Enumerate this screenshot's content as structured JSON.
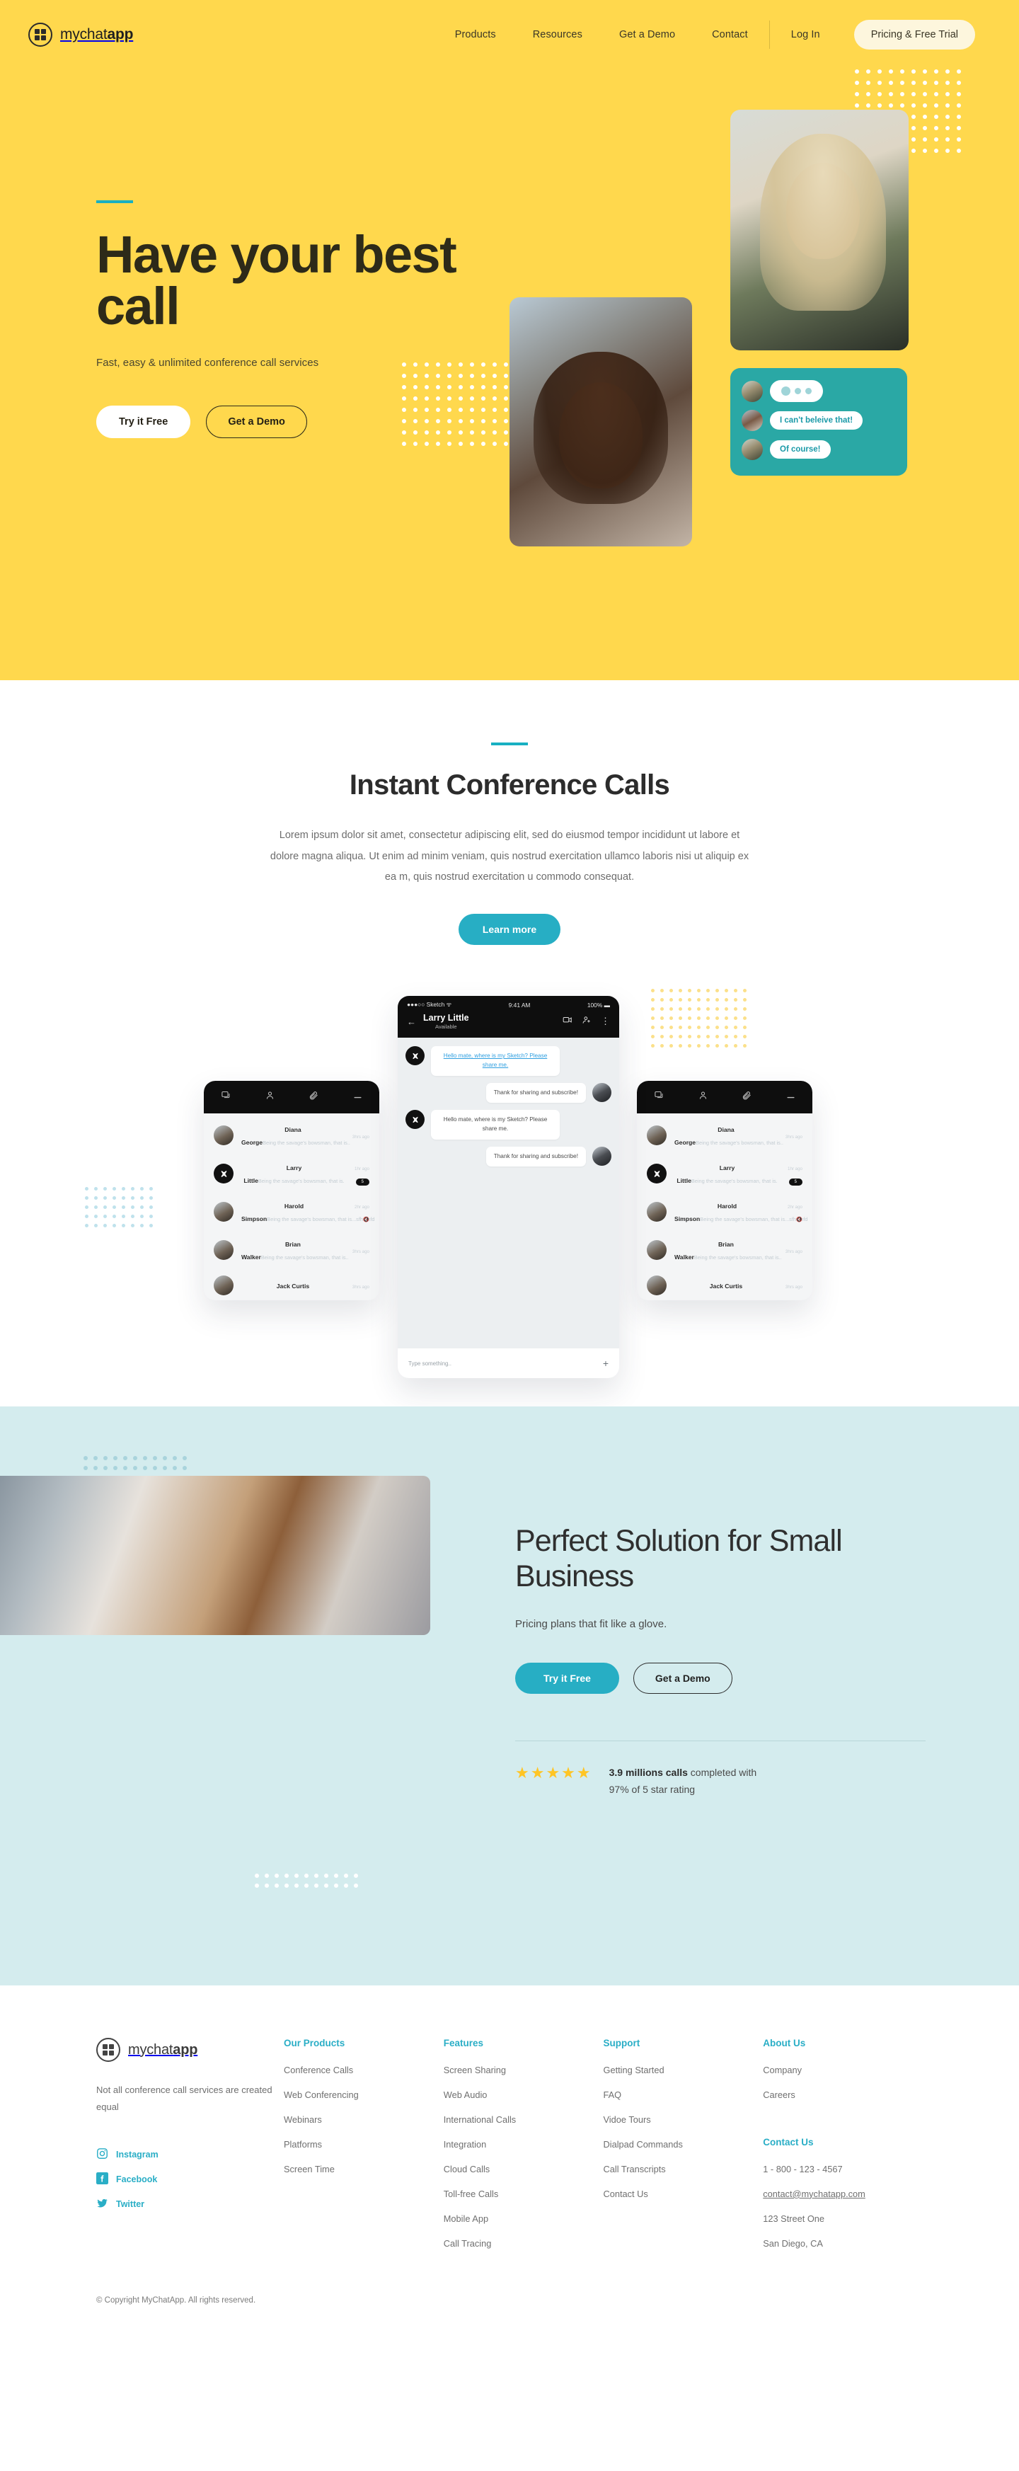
{
  "brand": {
    "name_light": "mychat",
    "name_bold": "app",
    "icon": "grid-logo-icon"
  },
  "nav": {
    "links": [
      {
        "label": "Products"
      },
      {
        "label": "Resources"
      },
      {
        "label": "Get a Demo"
      },
      {
        "label": "Contact"
      }
    ],
    "login_label": "Log In",
    "cta_label": "Pricing & Free Trial"
  },
  "hero": {
    "heading": "Have your best call",
    "subheading": "Fast, easy & unlimited conference call services",
    "primary_button": "Try it Free",
    "secondary_button": "Get a Demo",
    "accent_color": "#18b0c2",
    "background_color": "#ffd84d",
    "chat_card": {
      "background_color": "#2aa8a5",
      "messages": [
        {
          "text": "",
          "typing": true
        },
        {
          "text": "I can't beleive that!",
          "typing": false
        },
        {
          "text": "Of course!",
          "typing": false
        }
      ]
    }
  },
  "section_conference": {
    "title": "Instant Conference Calls",
    "body": "Lorem ipsum dolor sit amet, consectetur adipiscing elit, sed do eiusmod tempor incididunt ut labore et dolore magna aliqua. Ut enim ad minim veniam, quis nostrud exercitation ullamco laboris nisi ut aliquip ex ea m, quis nostrud exercitation u commodo consequat.",
    "button_label": "Learn more",
    "accent_color": "#18b0c2",
    "button_color": "#27aec4"
  },
  "phone_mockup": {
    "status_carrier": "Sketch",
    "status_time": "9:41 AM",
    "status_battery": "100%",
    "chat_title": "Larry Little",
    "chat_status": "Available",
    "input_placeholder": "Type something..",
    "messages": [
      {
        "side": "left",
        "text": "Hello mate, where is my Sketch? Please share me.",
        "link": true
      },
      {
        "side": "right",
        "text": "Thank for sharing and subscribe!",
        "link": false
      },
      {
        "side": "left",
        "text": "Hello mate, where is my Sketch? Please share me.",
        "link": false
      },
      {
        "side": "right",
        "text": "Thank for sharing and subscribe!",
        "link": false
      }
    ],
    "contacts": [
      {
        "name": "Diana George",
        "preview": "Being the savage's bowsman, that is..",
        "time": "3hrs ago",
        "badge": "",
        "muted": false
      },
      {
        "name": "Larry Little",
        "preview": "Being the savage's bowsman, that is.",
        "time": "1hr ago",
        "badge": "5",
        "muted": false
      },
      {
        "name": "Harold Simpson",
        "preview": "Being the savage's bowsman, that is...sfhdfhfd",
        "time": "2hr ago",
        "badge": "",
        "muted": true
      },
      {
        "name": "Brian Walker",
        "preview": "Being the savage's bowsman, that is..",
        "time": "3hrs ago",
        "badge": "",
        "muted": false
      },
      {
        "name": "Jack Curtis",
        "preview": "",
        "time": "3hrs ago",
        "badge": "",
        "muted": false
      }
    ],
    "tabbar_icons": [
      "chat-icon",
      "person-icon",
      "attachment-icon",
      "menu-icon"
    ]
  },
  "section_business": {
    "title": "Perfect Solution for Small Business",
    "subtitle": "Pricing plans that fit like a glove.",
    "primary_button": "Try it Free",
    "secondary_button": "Get a Demo",
    "stars": "★★★★★",
    "stat_bold": "3.9 millions calls",
    "stat_rest": " completed with",
    "stat_line2": "97% of 5 star rating",
    "background_color": "#d4ecee",
    "star_color": "#ffc525"
  },
  "footer": {
    "tagline": "Not all conference call services are created equal",
    "socials": [
      {
        "label": "Instagram",
        "icon": "instagram-icon"
      },
      {
        "label": "Facebook",
        "icon": "facebook-icon"
      },
      {
        "label": "Twitter",
        "icon": "twitter-icon"
      }
    ],
    "columns": [
      {
        "title": "Our Products",
        "links": [
          "Conference Calls",
          "Web Conferencing",
          "Webinars",
          "Platforms",
          "Screen Time"
        ]
      },
      {
        "title": "Features",
        "links": [
          "Screen Sharing",
          "Web Audio",
          "International Calls",
          "Integration",
          "Cloud Calls",
          "Toll-free Calls",
          "Mobile App",
          "Call Tracing"
        ]
      },
      {
        "title": "Support",
        "links": [
          "Getting Started",
          "FAQ",
          "Vidoe Tours",
          "Dialpad Commands",
          "Call Transcripts",
          "Contact Us"
        ]
      }
    ],
    "about": {
      "title": "About Us",
      "links": [
        "Company",
        "Careers"
      ]
    },
    "contact": {
      "title": "Contact Us",
      "phone": "1 - 800 - 123 - 4567",
      "email": "contact@mychatapp.com",
      "address1": "123 Street One",
      "address2": "San Diego, CA"
    },
    "copyright": "© Copyright MyChatApp. All rights reserved.",
    "accent_color": "#2aaec6"
  }
}
